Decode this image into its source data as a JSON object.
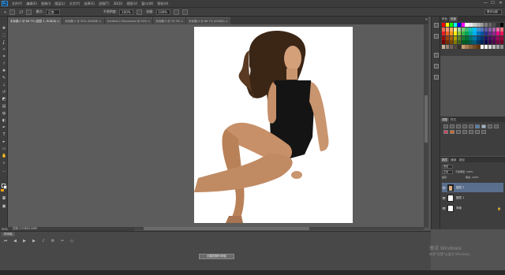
{
  "app": {
    "logo": "Ps"
  },
  "menu": [
    "文件(F)",
    "编辑(E)",
    "图像(I)",
    "图层(L)",
    "文字(Y)",
    "选择(S)",
    "滤镜(T)",
    "3D(D)",
    "视图(V)",
    "窗口(W)",
    "帮助(H)"
  ],
  "window_controls": {
    "minimize": "—",
    "maximize": "☐",
    "close": "✕"
  },
  "options": {
    "brush_size": "27",
    "mode_label": "模式:",
    "mode_value": "正常",
    "opacity_label": "不透明度:",
    "opacity_value": "100%",
    "flow_label": "流量:",
    "flow_value": "100%",
    "workspace": "基本功能"
  },
  "tabs": [
    {
      "label": "未标题-1 @ 66.7% (图层 1, RGB/8) ×",
      "active": true
    },
    {
      "label": "未标题-2 @ 50% (RGB/8) ×",
      "active": false
    },
    {
      "label": "Untitled-1-Recovered @ 50% ×",
      "active": false
    },
    {
      "label": "未标题-3 @ 33.3% ×",
      "active": false
    },
    {
      "label": "未标题-4 @ 66.7% (RGB/8) ×",
      "active": false
    }
  ],
  "tabs_overflow": "»",
  "status": {
    "zoom": "50%",
    "doc": "文档:1.03M/2.06M"
  },
  "timeline": {
    "tab": "时间轴",
    "create_button": "创建视频时间轴"
  },
  "panels": {
    "color_tabs": [
      "颜色",
      "色板"
    ],
    "adjust_tabs": [
      "调整",
      "样式"
    ],
    "layers_tabs": [
      "图层",
      "通道",
      "路径"
    ],
    "layers_kind": "类型",
    "layers_blend": "正常",
    "layers_opacity": "不透明度: 100%",
    "layers_lock": "锁定:",
    "layers_fill": "填充: 100%",
    "layers": [
      {
        "name": "图层 2",
        "thumb": "dark",
        "selected": true,
        "eye": "👁"
      },
      {
        "name": "图层 1",
        "thumb": "white",
        "selected": false,
        "eye": "👁"
      },
      {
        "name": "背景",
        "thumb": "white",
        "selected": false,
        "eye": "👁",
        "lock": "🔒"
      }
    ]
  },
  "swatch_colors": [
    "#ff0000",
    "#ffff00",
    "#00ff00",
    "#00ffff",
    "#0000ff",
    "#ff00ff",
    "#ffffff",
    "#e6e6e6",
    "#cccccc",
    "#b3b3b3",
    "#999999",
    "#808080",
    "#666666",
    "#4d4d4d",
    "#333333",
    "#000000",
    "#f26c4f",
    "#f69679",
    "#fbaf5d",
    "#fff68f",
    "#a2d39c",
    "#7cc576",
    "#3bb878",
    "#1abbb4",
    "#00bff3",
    "#438ccb",
    "#5574b9",
    "#605ca8",
    "#855fa8",
    "#a763a8",
    "#f06ea9",
    "#f26d7d",
    "#ed1c24",
    "#f26522",
    "#f7941d",
    "#fff200",
    "#8dc73f",
    "#39b54a",
    "#00a651",
    "#00a99d",
    "#00aeef",
    "#0072bc",
    "#0054a6",
    "#2e3192",
    "#662d91",
    "#92278f",
    "#ec008c",
    "#ed145b",
    "#9e0b0f",
    "#a0410d",
    "#a36209",
    "#aba000",
    "#598527",
    "#1a7b30",
    "#007236",
    "#00746b",
    "#0076a3",
    "#004b80",
    "#003471",
    "#1b1464",
    "#440e62",
    "#630460",
    "#9e005d",
    "#9e0039",
    "#790000",
    "#7b2e00",
    "#7d4900",
    "#827b00",
    "#406618",
    "#005e20",
    "#005826",
    "#005952",
    "#005b7f",
    "#003663",
    "#002157",
    "#0d004c",
    "#32004b",
    "#4b0049",
    "#7b0046",
    "#7a0026",
    "#c7b299",
    "#998675",
    "#736357",
    "#534741",
    "#37302d",
    "#c69c6d",
    "#a67c52",
    "#8c6239",
    "#754c24",
    "#603913",
    "#ffffff",
    "#f2f2f2",
    "#d9d9d9",
    "#bfbfbf",
    "#a6a6a6",
    "#8c8c8c"
  ],
  "watermark": {
    "line1": "激活 Windows",
    "line2": "转到\"设置\"以激活 Windows。"
  }
}
